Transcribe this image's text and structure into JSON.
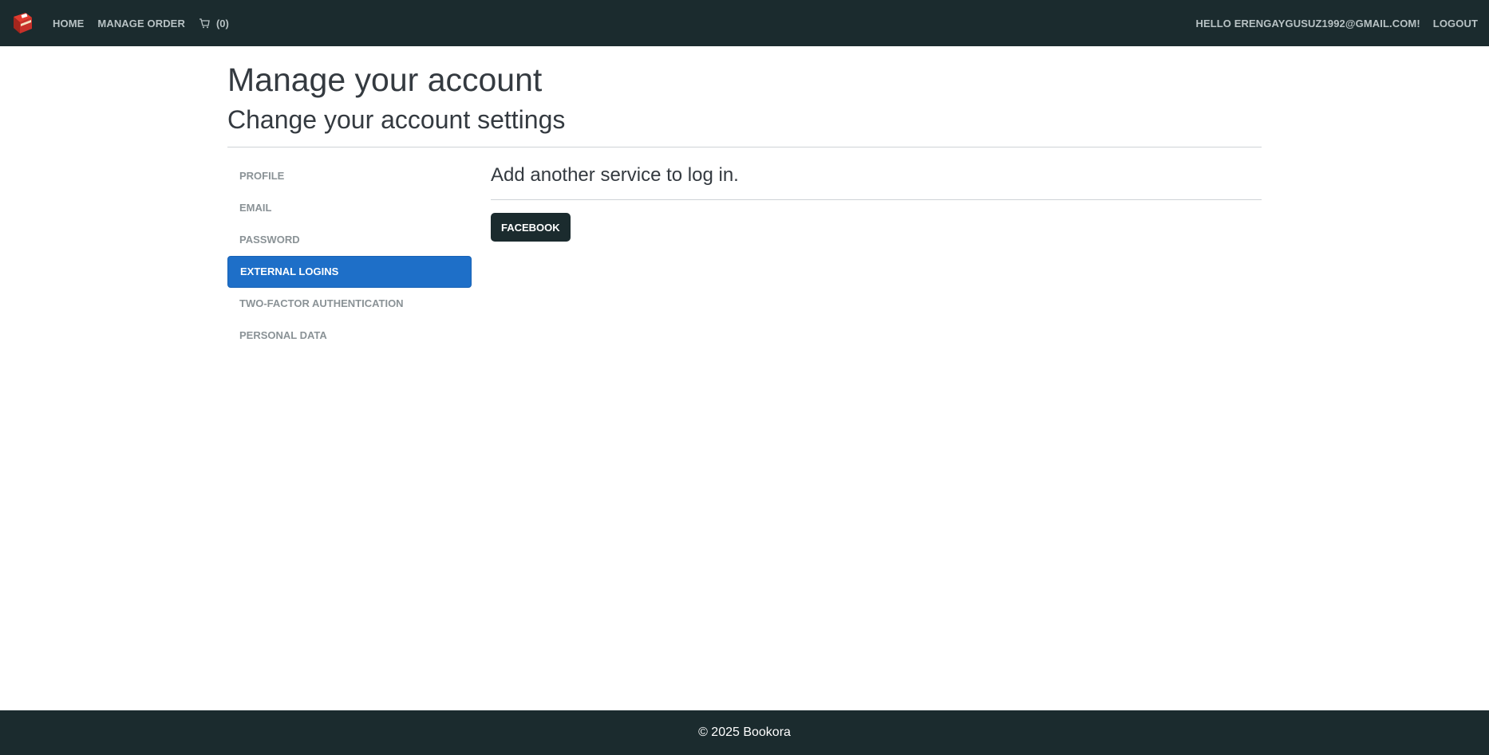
{
  "navbar": {
    "logo_icon": "book-icon",
    "home_label": "HOME",
    "manage_order_label": "MANAGE ORDER",
    "cart_icon": "cart-icon",
    "cart_count": "(0)",
    "greeting": "HELLO ERENGAYGUSUZ1992@GMAIL.COM!",
    "logout_label": "LOGOUT"
  },
  "header": {
    "title": "Manage your account",
    "subtitle": "Change your account settings"
  },
  "sidebar": {
    "items": [
      {
        "label": "PROFILE",
        "active": false
      },
      {
        "label": "EMAIL",
        "active": false
      },
      {
        "label": "PASSWORD",
        "active": false
      },
      {
        "label": "EXTERNAL LOGINS",
        "active": true
      },
      {
        "label": "TWO-FACTOR AUTHENTICATION",
        "active": false
      },
      {
        "label": "PERSONAL DATA",
        "active": false
      }
    ]
  },
  "main": {
    "heading": "Add another service to log in.",
    "facebook_button_label": "FACEBOOK"
  },
  "footer": {
    "text": "© 2025 Bookora"
  },
  "colors": {
    "navbar_bg": "#1b2b2e",
    "active_item": "#1e6fc8"
  }
}
